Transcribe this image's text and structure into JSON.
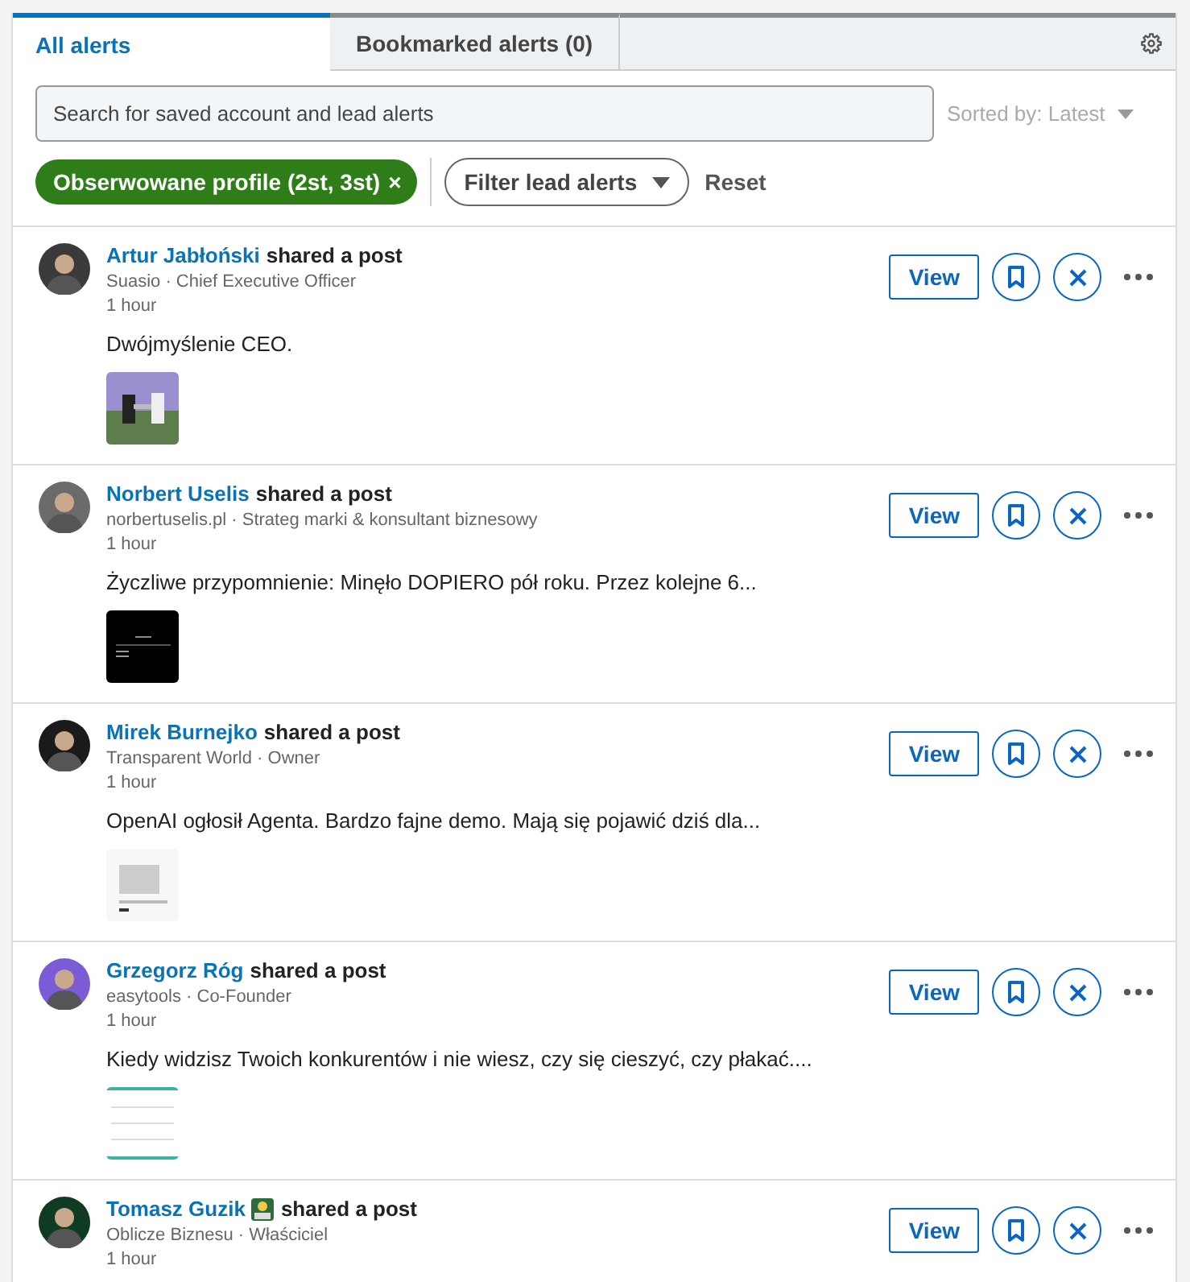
{
  "tabs": [
    {
      "label": "All alerts",
      "selected": true
    },
    {
      "label": "Bookmarked alerts (0)",
      "selected": false
    }
  ],
  "search": {
    "placeholder": "Search for saved account and lead alerts"
  },
  "sort": {
    "label": "Sorted by: Latest"
  },
  "filters": {
    "chip": {
      "label": "Obserwowane profile (2st, 3st)",
      "remove": "×"
    },
    "dropdown": "Filter lead alerts",
    "reset": "Reset"
  },
  "alerts": [
    {
      "name": "Artur Jabłoński",
      "badge": false,
      "action": "shared a post",
      "meta": "Suasio · Chief Executive Officer",
      "time": "1 hour",
      "text": "Dwójmyślenie CEO.",
      "view": "View"
    },
    {
      "name": "Norbert Uselis",
      "badge": false,
      "action": "shared a post",
      "meta": "norbertuselis.pl · Strateg marki & konsultant biznesowy",
      "time": "1 hour",
      "text": "Życzliwe przypomnienie: Minęło DOPIERO pół roku. Przez kolejne 6...",
      "view": "View"
    },
    {
      "name": "Mirek Burnejko",
      "badge": false,
      "action": "shared a post",
      "meta": "Transparent World · Owner",
      "time": "1 hour",
      "text": "OpenAI ogłosił Agenta. Bardzo fajne demo. Mają się pojawić dziś dla...",
      "view": "View"
    },
    {
      "name": "Grzegorz Róg",
      "badge": false,
      "action": "shared a post",
      "meta": "easytools · Co-Founder",
      "time": "1 hour",
      "text": "Kiedy widzisz Twoich konkurentów i nie wiesz, czy się cieszyć, czy płakać....",
      "view": "View"
    },
    {
      "name": "Tomasz Guzik",
      "badge": true,
      "action": "shared a post",
      "meta": "Oblicze Biznesu · Właściciel",
      "time": "1 hour",
      "view": "View"
    }
  ]
}
